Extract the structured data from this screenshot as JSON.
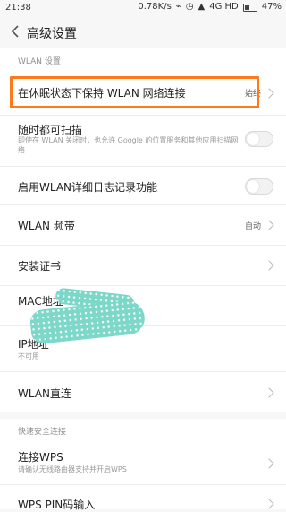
{
  "status_bar": {
    "time": "21:38",
    "speed": "0.78K/s",
    "network": "4G HD",
    "battery": "47%"
  },
  "toolbar": {
    "title": "高级设置"
  },
  "sections": {
    "wlan_label": "WLAN 设置",
    "wps_label": "快速安全连接"
  },
  "items": {
    "keep_wlan": {
      "label": "在休眠状态下保持 WLAN 网络连接",
      "value": "始终"
    },
    "scan": {
      "label": "随时都可扫描",
      "sub": "即使在 WLAN 关闭时，也允许 Google 的位置服务和其他应用扫描网络"
    },
    "detail_log": {
      "label": "启用WLAN详细日志记录功能"
    },
    "band": {
      "label": "WLAN 频带",
      "value": "自动"
    },
    "cert": {
      "label": "安装证书"
    },
    "mac": {
      "label": "MAC地址"
    },
    "ip": {
      "label": "IP地址",
      "sub": "不可用"
    },
    "direct": {
      "label": "WLAN直连"
    },
    "wps": {
      "label": "连接WPS",
      "sub": "请确认无线路由器支持并开启WPS"
    },
    "wps_pin": {
      "label": "WPS PIN码输入"
    }
  },
  "colors": {
    "highlight": "#ff7a1a",
    "scribble": "#7bd8c9"
  }
}
